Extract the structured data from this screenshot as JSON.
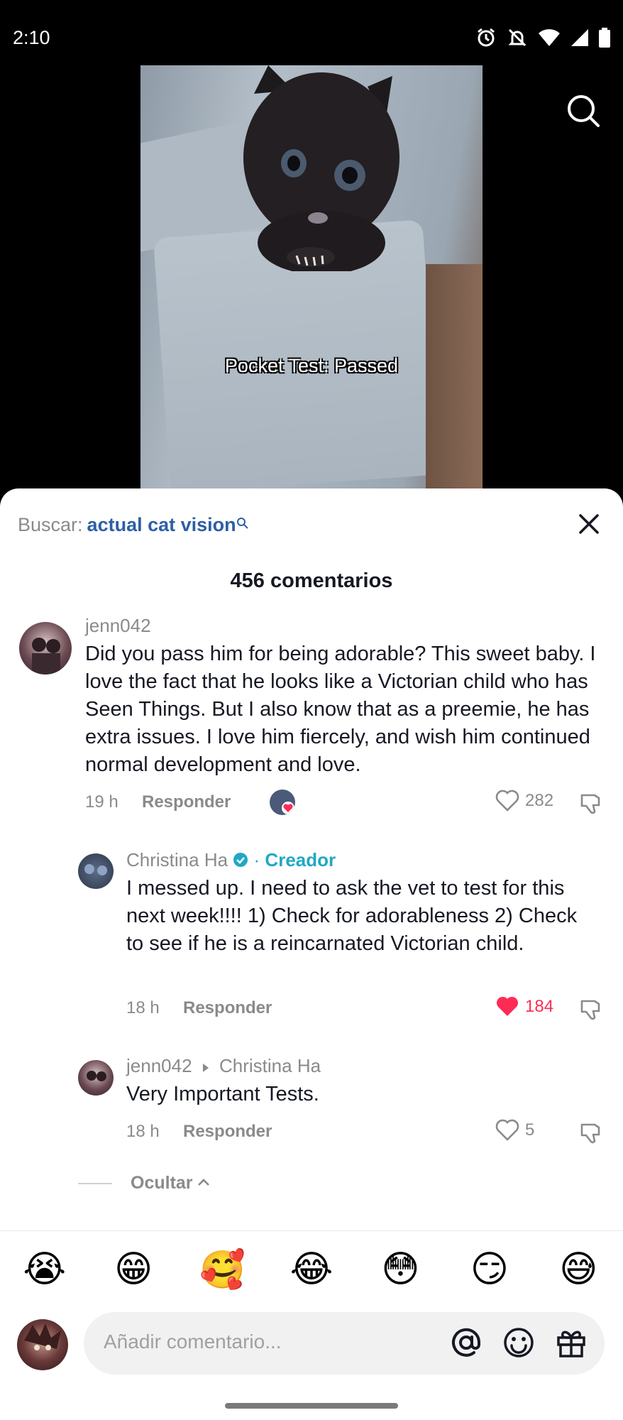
{
  "status_bar": {
    "time": "2:10"
  },
  "video": {
    "caption": "Pocket Test: Passed"
  },
  "sheet": {
    "search_prefix": "Buscar:",
    "search_query": "actual cat vision",
    "comment_count": "456 comentarios"
  },
  "comments": [
    {
      "username": "jenn042",
      "text": "Did you pass him for being adorable? This sweet baby. I love the fact that he looks like a Victorian child who has Seen Things. But I also know that as a preemie, he has extra issues. I love him fiercely, and wish him continued normal development and love.",
      "time": "19 h",
      "reply_label": "Responder",
      "likes": "282"
    },
    {
      "username": "Christina Ha",
      "creator_label": "Creador",
      "text": "I messed up. I need to ask the vet to test for this next week!!!! 1) Check for adorableness 2) Check to see if he is a reincarnated Victorian child.",
      "time": "18 h",
      "reply_label": "Responder",
      "likes": "184"
    },
    {
      "username": "jenn042",
      "reply_to": "Christina Ha",
      "text": "Very Important Tests.",
      "time": "18 h",
      "reply_label": "Responder",
      "likes": "5"
    }
  ],
  "hide_label": "Ocultar",
  "emojis": [
    "😭",
    "😁",
    "🥰",
    "😂",
    "😳",
    "😏",
    "😅"
  ],
  "composer": {
    "placeholder": "Añadir comentario..."
  },
  "colors": {
    "accent_link": "#2d5fa5",
    "creator": "#20a8c4",
    "like_active": "#fe2c55"
  }
}
